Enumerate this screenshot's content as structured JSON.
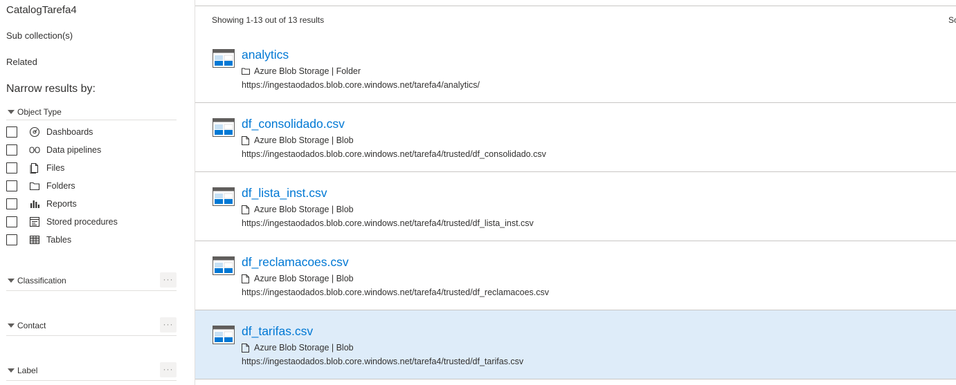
{
  "sidebar": {
    "title": "CatalogTarefa4",
    "sub_collections": "Sub collection(s)",
    "related": "Related",
    "narrow_by": "Narrow results by:",
    "object_type": {
      "label": "Object Type",
      "items": [
        {
          "label": "Dashboards",
          "icon": "dashboard-icon"
        },
        {
          "label": "Data pipelines",
          "icon": "pipeline-icon"
        },
        {
          "label": "Files",
          "icon": "file-icon"
        },
        {
          "label": "Folders",
          "icon": "folder-icon"
        },
        {
          "label": "Reports",
          "icon": "report-icon"
        },
        {
          "label": "Stored procedures",
          "icon": "stored-procedure-icon"
        },
        {
          "label": "Tables",
          "icon": "table-icon"
        }
      ]
    },
    "classification": {
      "label": "Classification",
      "more": "···"
    },
    "contact": {
      "label": "Contact",
      "more": "···"
    },
    "label_section": {
      "label": "Label",
      "more": "···"
    }
  },
  "main": {
    "showing": "Showing 1-13 out of 13 results",
    "sort_cut": "Sc",
    "results": [
      {
        "name": "analytics",
        "meta": "Azure Blob Storage | Folder",
        "meta_icon": "folder-icon",
        "path": "https://ingestaodados.blob.core.windows.net/tarefa4/analytics/",
        "selected": false
      },
      {
        "name": "df_consolidado.csv",
        "meta": "Azure Blob Storage | Blob",
        "meta_icon": "file-icon",
        "path": "https://ingestaodados.blob.core.windows.net/tarefa4/trusted/df_consolidado.csv",
        "selected": false
      },
      {
        "name": "df_lista_inst.csv",
        "meta": "Azure Blob Storage | Blob",
        "meta_icon": "file-icon",
        "path": "https://ingestaodados.blob.core.windows.net/tarefa4/trusted/df_lista_inst.csv",
        "selected": false
      },
      {
        "name": "df_reclamacoes.csv",
        "meta": "Azure Blob Storage | Blob",
        "meta_icon": "file-icon",
        "path": "https://ingestaodados.blob.core.windows.net/tarefa4/trusted/df_reclamacoes.csv",
        "selected": false
      },
      {
        "name": "df_tarifas.csv",
        "meta": "Azure Blob Storage | Blob",
        "meta_icon": "file-icon",
        "path": "https://ingestaodados.blob.core.windows.net/tarefa4/trusted/df_tarifas.csv",
        "selected": true
      }
    ]
  },
  "colors": {
    "link": "#0078d4",
    "selected_row": "#deecf9",
    "asset_icon_blue": "#0078d4",
    "asset_icon_gray": "#605e5c"
  }
}
